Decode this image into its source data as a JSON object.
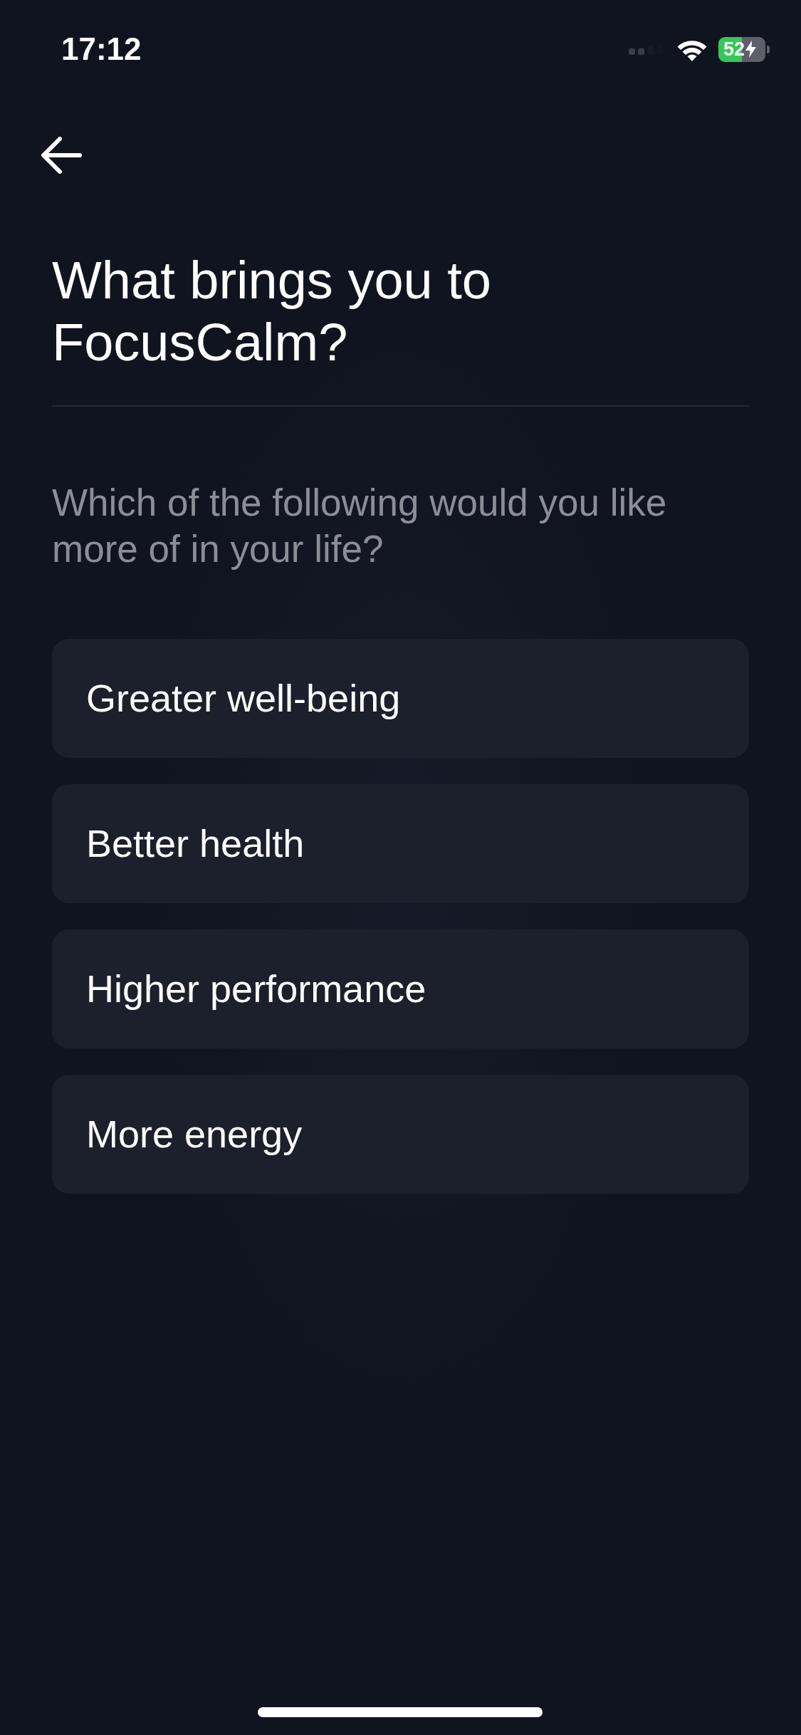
{
  "status_bar": {
    "time": "17:12",
    "battery": "52"
  },
  "title": "What brings you to FocusCalm?",
  "subtitle": "Which of the following would you like more of in your life?",
  "options": [
    {
      "label": "Greater well-being",
      "selected": false
    },
    {
      "label": "Better health",
      "selected": false
    },
    {
      "label": "Higher performance",
      "selected": false
    },
    {
      "label": "More energy",
      "selected": false
    }
  ]
}
